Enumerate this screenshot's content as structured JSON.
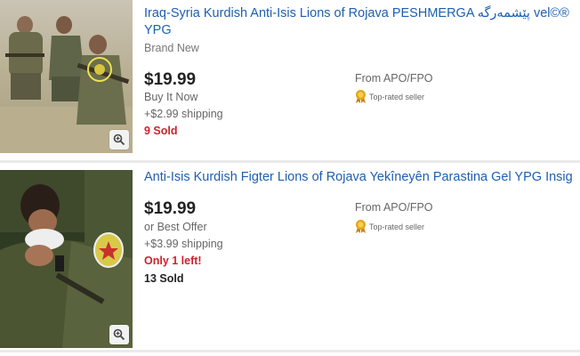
{
  "listings": [
    {
      "title": "Iraq-Syria Kurdish Anti-Isis Lions of Rojava PESHMERGA پێشمەرگە vel©® YPG",
      "subtitle": "Brand New",
      "price": "$19.99",
      "format": "Buy It Now",
      "shipping": "+$2.99 shipping",
      "sold": "9 Sold",
      "location": "From APO/FPO",
      "seller_badge": "Top-rated seller",
      "icons": [
        "zoom-icon",
        "top-rated-badge-icon"
      ]
    },
    {
      "title": "Anti-Isis Kurdish Figter Lions of Rojava Yekîneyên Parastina Gel YPG Insig",
      "price": "$19.99",
      "format": "or Best Offer",
      "shipping": "+$3.99 shipping",
      "stock_notice": "Only 1 left!",
      "sold": "13 Sold",
      "location": "From APO/FPO",
      "seller_badge": "Top-rated seller",
      "icons": [
        "zoom-icon",
        "top-rated-badge-icon"
      ]
    }
  ],
  "colors": {
    "link": "#1d5fb0",
    "alert": "#d1202b",
    "badge": "#e3a51b"
  }
}
